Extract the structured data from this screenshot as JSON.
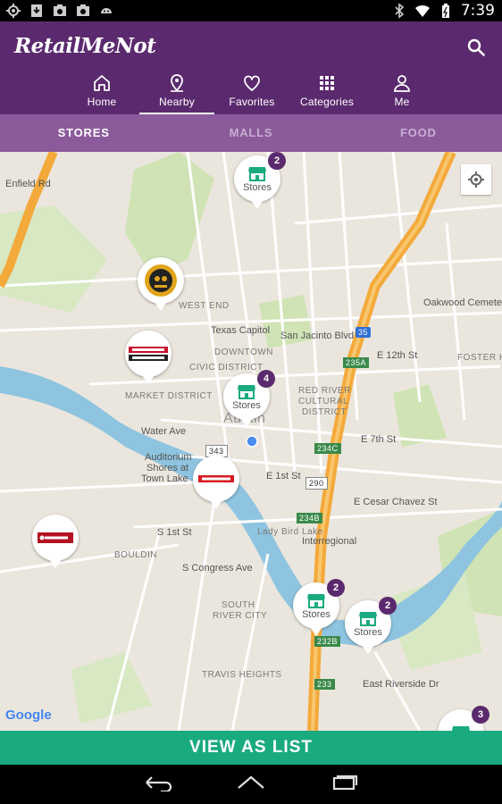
{
  "status_bar": {
    "time": "7:39"
  },
  "app": {
    "logo": "RetailMeNot"
  },
  "nav": {
    "items": [
      {
        "label": "Home",
        "icon": "home-icon"
      },
      {
        "label": "Nearby",
        "icon": "location-pin-icon",
        "active": true
      },
      {
        "label": "Favorites",
        "icon": "heart-icon"
      },
      {
        "label": "Categories",
        "icon": "grid-icon"
      },
      {
        "label": "Me",
        "icon": "person-icon"
      }
    ]
  },
  "subtabs": [
    {
      "label": "STORES",
      "active": true
    },
    {
      "label": "MALLS"
    },
    {
      "label": "FOOD"
    }
  ],
  "map": {
    "labels": {
      "texas_capitol": "Texas Capitol",
      "west_end": "WEST END",
      "downtown": "DOWNTOWN",
      "civic_district": "CIVIC DISTRICT",
      "market_district": "MARKET DISTRICT",
      "red_river": "RED RIVER",
      "cultural": "CULTURAL",
      "district": "DISTRICT",
      "austin": "Austin",
      "water_ave": "Water Ave",
      "auditorium": "Auditorium",
      "shores_at": "Shores at",
      "town_lake": "Town Lake",
      "bouldin": "BOULDIN",
      "south": "SOUTH",
      "river_city": "RIVER CITY",
      "travis_heights": "TRAVIS HEIGHTS",
      "foster_heights": "FOSTER HE",
      "oakwood": "Oakwood Cemetery",
      "e_12th": "E 12th St",
      "e_7th": "E 7th St",
      "e_1st": "E 1st St",
      "e_cesar": "E Cesar Chavez St",
      "s_1st": "S 1st St",
      "s_congress": "S Congress Ave",
      "san_jacinto": "San Jacinto Blvd",
      "lady_bird": "Lady Bird Lake",
      "interregional": "Interregional",
      "enfield": "Enfield Rd",
      "riverside": "East Riverside Dr",
      "shields": [
        "35",
        "235A",
        "234C",
        "234B",
        "232B",
        "233",
        "343",
        "290"
      ]
    },
    "pins": [
      {
        "label": "Stores",
        "badge": "2"
      },
      {
        "label": "Stores",
        "badge": "4"
      },
      {
        "label": "Stores",
        "badge": "2"
      },
      {
        "label": "Stores",
        "badge": "2"
      },
      {
        "label": "",
        "badge": "3"
      }
    ],
    "brand_pins": [
      "Einstein Bros Bagels",
      "Office Depot OfficeMax",
      "Firestone",
      "Jiffy Lube"
    ],
    "attribution": "Google"
  },
  "cta": {
    "label": "VIEW AS LIST"
  },
  "colors": {
    "brand": "#5b2a6e",
    "subtab_bg": "#8a5a9b",
    "cta": "#1aaa80",
    "highway": "#f4a93b"
  }
}
